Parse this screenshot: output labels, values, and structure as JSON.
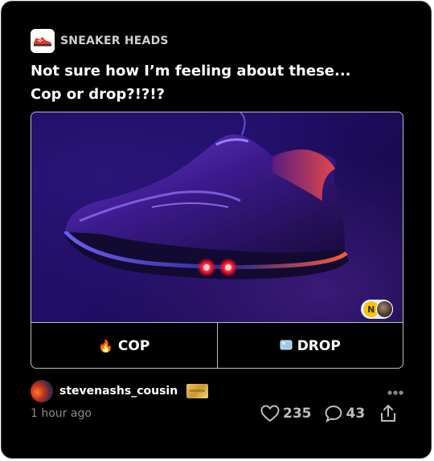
{
  "community": {
    "name": "SNEAKER HEADS",
    "icon": "sneaker-icon"
  },
  "post": {
    "title": "Not sure how I’m feeling about these... Cop or drop?!?!?",
    "image": "sneaker-photo",
    "voters": {
      "initial": "N"
    }
  },
  "poll": {
    "options": [
      {
        "label": "COP",
        "icon": "fire-emoji"
      },
      {
        "label": "DROP",
        "icon": "ice-cube-emoji"
      }
    ]
  },
  "author": {
    "username": "stevenashs_cousin",
    "badge": "gold-badge-icon"
  },
  "meta": {
    "timestamp": "1 hour ago"
  },
  "stats": {
    "likes": "235",
    "comments": "43"
  },
  "colors": {
    "background": "#000000",
    "text": "#ffffff",
    "muted": "#8a8a8a",
    "border": "#bdbdbd"
  }
}
